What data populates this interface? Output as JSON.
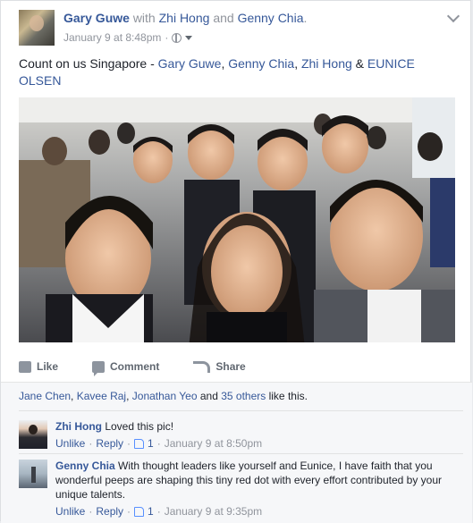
{
  "post": {
    "author": "Gary Guwe",
    "with_word": "with",
    "tag1": "Zhi Hong",
    "and_word": "and",
    "tag2": "Genny Chia",
    "period": ".",
    "timestamp": "January 9 at 8:48pm",
    "dot_sep": "·",
    "text_prefix": "Count on us Singapore - ",
    "mention1": "Gary Guwe",
    "sep1": ", ",
    "mention2": "Genny Chia",
    "sep2": ", ",
    "mention3": "Zhi Hong",
    "amp": " & ",
    "mention4": "EUNICE OLSEN"
  },
  "actions": {
    "like": "Like",
    "comment": "Comment",
    "share": "Share"
  },
  "likes": {
    "name1": "Jane Chen",
    "sep1": ", ",
    "name2": "Kavee Raj",
    "sep2": ", ",
    "name3": "Jonathan Yeo",
    "and_word": " and ",
    "others": "35 others",
    "suffix": " like this."
  },
  "comments": [
    {
      "name": "Zhi Hong",
      "text": "Loved this pic!",
      "unlike": "Unlike",
      "reply": "Reply",
      "likes": "1",
      "time": "January 9 at 8:50pm"
    },
    {
      "name": "Genny Chia",
      "text": "With thought leaders like yourself and Eunice, I have faith that you wonderful peeps are shaping this tiny red dot with every effort contributed by your unique talents.",
      "unlike": "Unlike",
      "reply": "Reply",
      "likes": "1",
      "time": "January 9 at 9:35pm"
    }
  ],
  "colors": {
    "link": "#365899",
    "meta": "#90949c",
    "accent": "#5890ff"
  }
}
